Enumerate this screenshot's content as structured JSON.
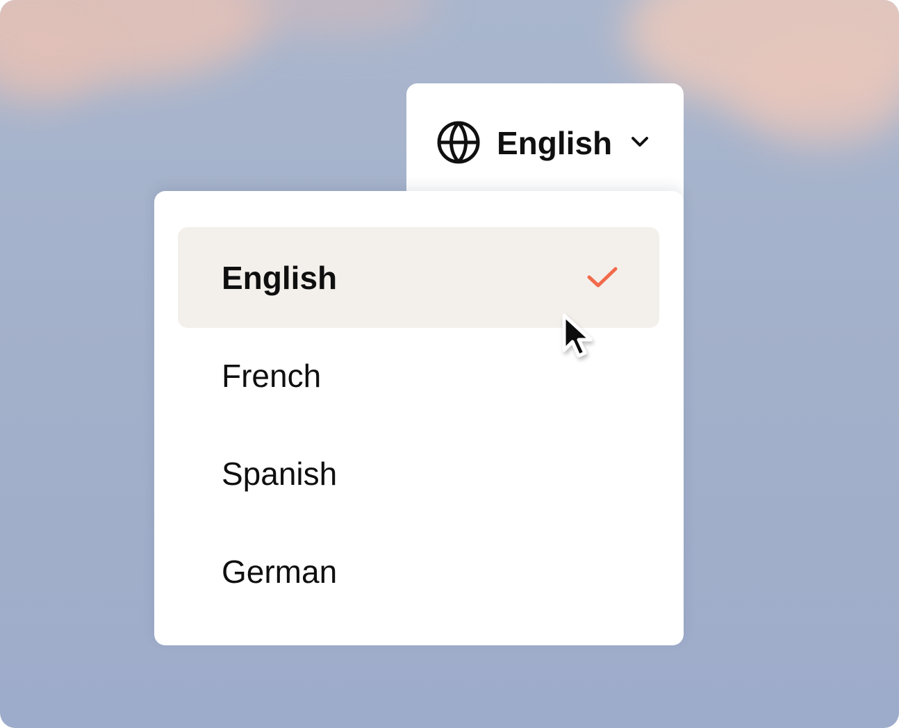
{
  "language_selector": {
    "current_label": "English",
    "icon": "globe-icon",
    "expand_icon": "chevron-down-icon"
  },
  "dropdown": {
    "options": [
      {
        "label": "English",
        "selected": true
      },
      {
        "label": "French",
        "selected": false
      },
      {
        "label": "Spanish",
        "selected": false
      },
      {
        "label": "German",
        "selected": false
      }
    ],
    "selected_icon": "check-icon"
  },
  "colors": {
    "accent": "#f26a4b",
    "selected_background": "#f3efea",
    "background_sky": "#a3b0ca"
  }
}
